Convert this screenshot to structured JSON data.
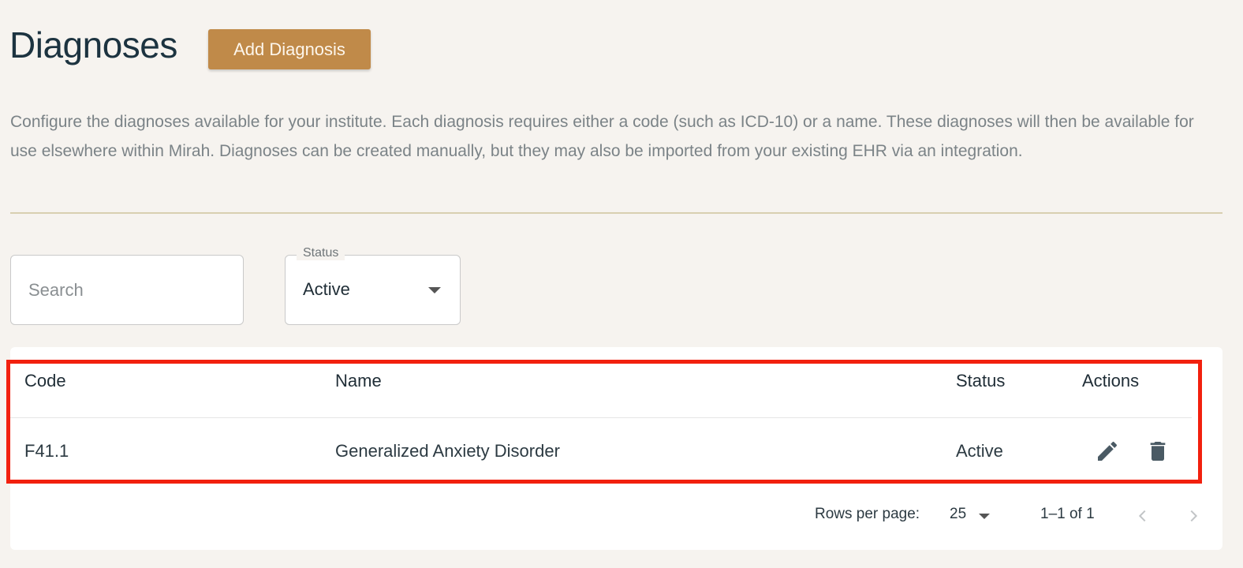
{
  "header": {
    "title": "Diagnoses",
    "add_button_label": "Add Diagnosis"
  },
  "description": "Configure the diagnoses available for your institute. Each diagnosis requires either a code (such as ICD-10) or a name. These diagnoses will then be available for use elsewhere within Mirah. Diagnoses can be created manually, but they may also be imported from your existing EHR via an integration.",
  "filters": {
    "search_placeholder": "Search",
    "status_label": "Status",
    "status_value": "Active"
  },
  "table": {
    "columns": [
      "Code",
      "Name",
      "Status",
      "Actions"
    ],
    "rows": [
      {
        "code": "F41.1",
        "name": "Generalized Anxiety Disorder",
        "status": "Active"
      }
    ]
  },
  "pagination": {
    "rows_per_page_label": "Rows per page:",
    "rows_per_page_value": "25",
    "range_text": "1–1 of 1"
  },
  "colors": {
    "accent": "#c08a49",
    "highlight": "#f2200e",
    "title": "#1c3340",
    "background": "#f6f3ef"
  },
  "icons": {
    "edit": "pencil-icon",
    "delete": "trash-icon",
    "prev": "chevron-left-icon",
    "next": "chevron-right-icon",
    "dropdown": "caret-down-icon"
  }
}
